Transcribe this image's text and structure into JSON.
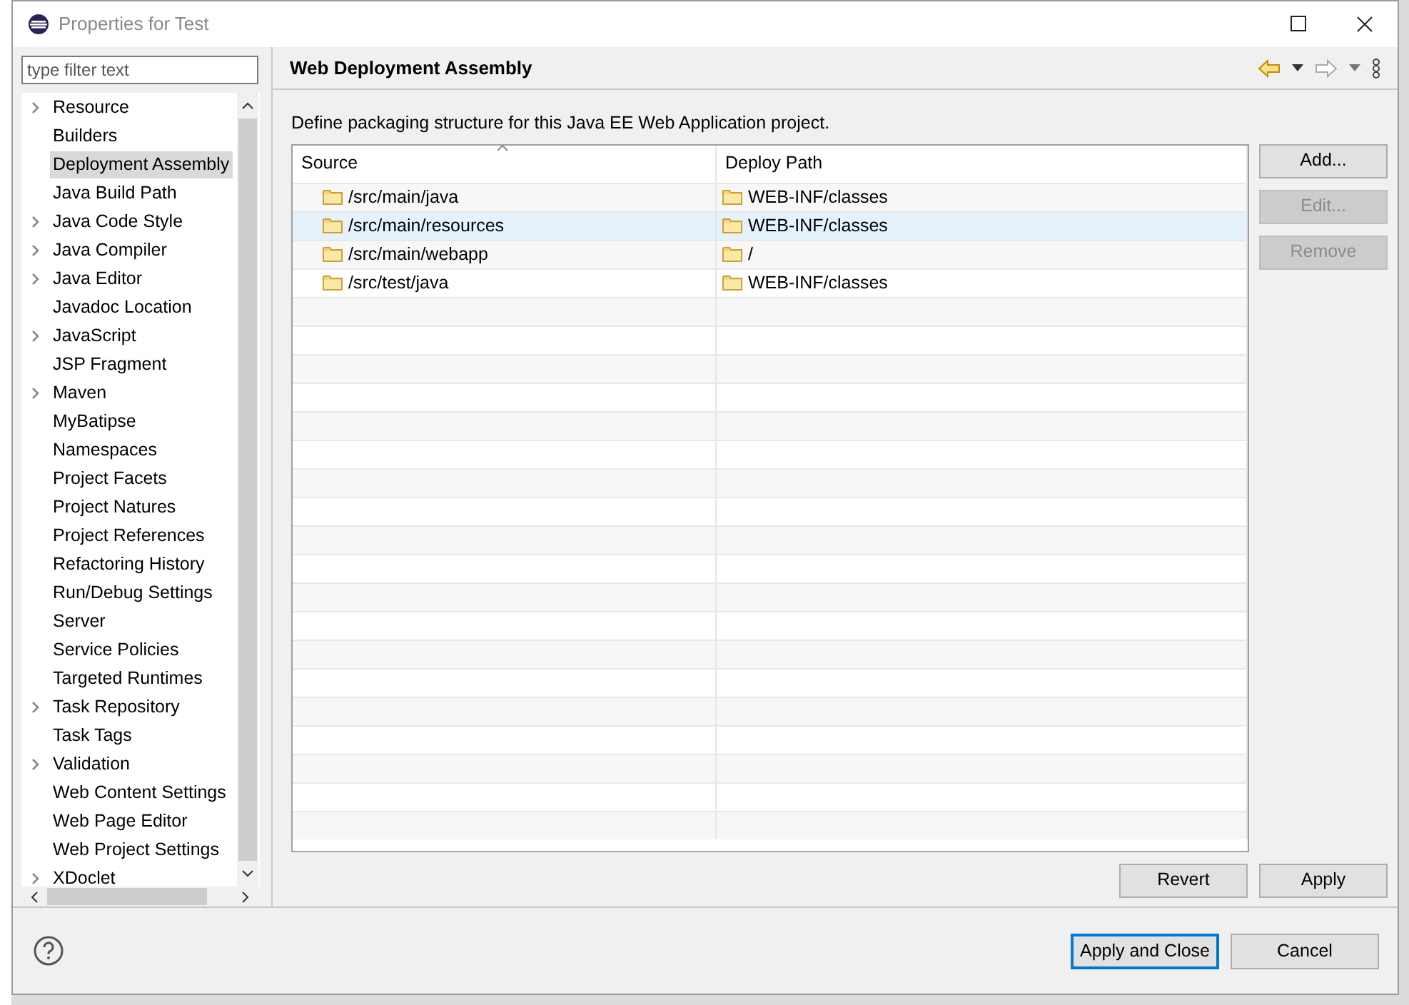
{
  "window": {
    "title": "Properties for Test"
  },
  "filter": {
    "placeholder": "type filter text"
  },
  "tree": [
    {
      "label": "Resource",
      "expandable": true,
      "selected": false
    },
    {
      "label": "Builders",
      "expandable": false,
      "selected": false
    },
    {
      "label": "Deployment Assembly",
      "expandable": false,
      "selected": true
    },
    {
      "label": "Java Build Path",
      "expandable": false,
      "selected": false
    },
    {
      "label": "Java Code Style",
      "expandable": true,
      "selected": false
    },
    {
      "label": "Java Compiler",
      "expandable": true,
      "selected": false
    },
    {
      "label": "Java Editor",
      "expandable": true,
      "selected": false
    },
    {
      "label": "Javadoc Location",
      "expandable": false,
      "selected": false
    },
    {
      "label": "JavaScript",
      "expandable": true,
      "selected": false
    },
    {
      "label": "JSP Fragment",
      "expandable": false,
      "selected": false
    },
    {
      "label": "Maven",
      "expandable": true,
      "selected": false
    },
    {
      "label": "MyBatipse",
      "expandable": false,
      "selected": false
    },
    {
      "label": "Namespaces",
      "expandable": false,
      "selected": false
    },
    {
      "label": "Project Facets",
      "expandable": false,
      "selected": false
    },
    {
      "label": "Project Natures",
      "expandable": false,
      "selected": false
    },
    {
      "label": "Project References",
      "expandable": false,
      "selected": false
    },
    {
      "label": "Refactoring History",
      "expandable": false,
      "selected": false
    },
    {
      "label": "Run/Debug Settings",
      "expandable": false,
      "selected": false
    },
    {
      "label": "Server",
      "expandable": false,
      "selected": false
    },
    {
      "label": "Service Policies",
      "expandable": false,
      "selected": false
    },
    {
      "label": "Targeted Runtimes",
      "expandable": false,
      "selected": false
    },
    {
      "label": "Task Repository",
      "expandable": true,
      "selected": false
    },
    {
      "label": "Task Tags",
      "expandable": false,
      "selected": false
    },
    {
      "label": "Validation",
      "expandable": true,
      "selected": false
    },
    {
      "label": "Web Content Settings",
      "expandable": false,
      "selected": false
    },
    {
      "label": "Web Page Editor",
      "expandable": false,
      "selected": false
    },
    {
      "label": "Web Project Settings",
      "expandable": false,
      "selected": false
    },
    {
      "label": "XDoclet",
      "expandable": true,
      "selected": false
    }
  ],
  "page": {
    "title": "Web Deployment Assembly",
    "description": "Define packaging structure for this Java EE Web Application project."
  },
  "table": {
    "columns": [
      "Source",
      "Deploy Path"
    ],
    "rows": [
      {
        "source": "/src/main/java",
        "deploy_path": "WEB-INF/classes",
        "selected": false
      },
      {
        "source": "/src/main/resources",
        "deploy_path": "WEB-INF/classes",
        "selected": true
      },
      {
        "source": "/src/main/webapp",
        "deploy_path": "/",
        "selected": false
      },
      {
        "source": "/src/test/java",
        "deploy_path": "WEB-INF/classes",
        "selected": false
      }
    ]
  },
  "side_buttons": [
    {
      "label": "Add...",
      "disabled": false
    },
    {
      "label": "Edit...",
      "disabled": true
    },
    {
      "label": "Remove",
      "disabled": true
    }
  ],
  "page_buttons": [
    "Revert",
    "Apply"
  ],
  "footer_buttons": [
    {
      "label": "Apply and Close",
      "default": true
    },
    {
      "label": "Cancel",
      "default": false
    }
  ]
}
